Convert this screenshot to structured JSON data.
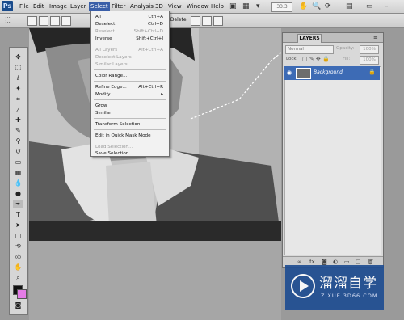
{
  "app": {
    "logo": "Ps",
    "zoom": "33.3"
  },
  "menubar": {
    "items": [
      "File",
      "Edit",
      "Image",
      "Layer",
      "Select",
      "Filter",
      "Analysis",
      "3D",
      "View",
      "Window",
      "Help"
    ],
    "active": "Select"
  },
  "options_bar": {
    "mode_text": "d/Delete"
  },
  "select_menu": [
    {
      "label": "All",
      "shortcut": "Ctrl+A",
      "enabled": true
    },
    {
      "label": "Deselect",
      "shortcut": "Ctrl+D",
      "enabled": true
    },
    {
      "label": "Reselect",
      "shortcut": "Shift+Ctrl+D",
      "enabled": false
    },
    {
      "label": "Inverse",
      "shortcut": "Shift+Ctrl+I",
      "enabled": true
    },
    {
      "label": "All Layers",
      "shortcut": "Alt+Ctrl+A",
      "enabled": false
    },
    {
      "label": "Deselect Layers",
      "shortcut": "",
      "enabled": false
    },
    {
      "label": "Similar Layers",
      "shortcut": "",
      "enabled": false
    },
    {
      "label": "Color Range...",
      "shortcut": "",
      "enabled": true
    },
    {
      "label": "Refine Edge...",
      "shortcut": "Alt+Ctrl+R",
      "enabled": true
    },
    {
      "label": "Modify",
      "shortcut": "▸",
      "enabled": true
    },
    {
      "label": "Grow",
      "shortcut": "",
      "enabled": true
    },
    {
      "label": "Similar",
      "shortcut": "",
      "enabled": true
    },
    {
      "label": "Transform Selection",
      "shortcut": "",
      "enabled": true
    },
    {
      "label": "Edit in Quick Mask Mode",
      "shortcut": "",
      "enabled": true
    },
    {
      "label": "Load Selection...",
      "shortcut": "",
      "enabled": false
    },
    {
      "label": "Save Selection...",
      "shortcut": "",
      "enabled": true
    }
  ],
  "layers_panel": {
    "tab": "LAYERS",
    "blend_mode": "Normal",
    "opacity_label": "Opacity:",
    "opacity_value": "100%",
    "lock_label": "Lock:",
    "fill_label": "Fill:",
    "fill_value": "100%",
    "layer_name": "Background"
  },
  "watermark": {
    "title": "溜溜自学",
    "url": "ZIXUE.3D66.COM"
  },
  "colors": {
    "menu_highlight": "#3a5fa8",
    "layer_selected": "#3d6bb5",
    "background_color_swatch": "#e47ce6"
  }
}
